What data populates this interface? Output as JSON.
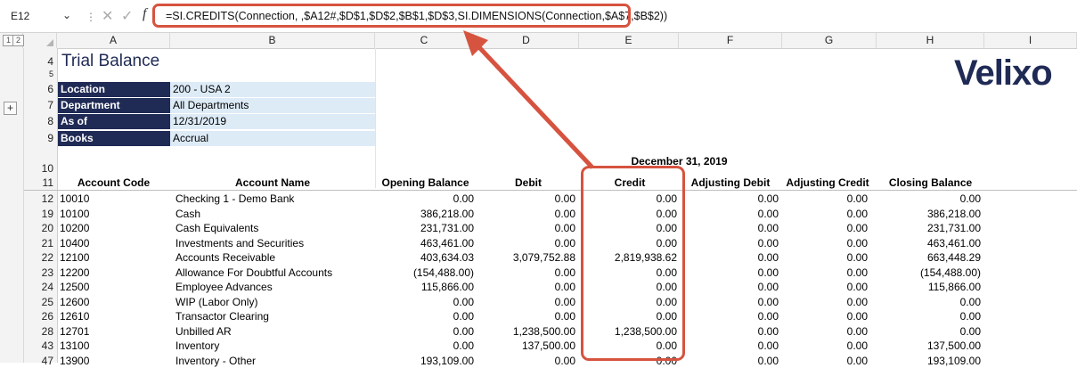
{
  "name_box": "E12",
  "formula": "=SI.CREDITS(Connection, ,$A12#,$D$1,$D$2,$B$1,$D$3,SI.DIMENSIONS(Connection,$A$7,$B$2))",
  "outline_levels": [
    "1",
    "2"
  ],
  "outline_expand": "+",
  "columns": [
    "A",
    "B",
    "C",
    "D",
    "E",
    "F",
    "G",
    "H",
    "I"
  ],
  "title": "Trial Balance",
  "logo_text": "Velixo",
  "params": [
    {
      "label": "Location",
      "value": "200 - USA 2"
    },
    {
      "label": "Department",
      "value": "All Departments"
    },
    {
      "label": "As of",
      "value": "12/31/2019"
    },
    {
      "label": "Books",
      "value": "Accrual"
    }
  ],
  "period_heading": "December 31, 2019",
  "table_headers": [
    "Account Code",
    "Account Name",
    "Opening Balance",
    "Debit",
    "Credit",
    "Adjusting Debit",
    "Adjusting Credit",
    "Closing Balance"
  ],
  "rows": [
    {
      "row": "12",
      "code": "10010",
      "name": "Checking 1 - Demo Bank",
      "opening": "0.00",
      "debit": "0.00",
      "credit": "0.00",
      "adj_debit": "0.00",
      "adj_credit": "0.00",
      "closing": "0.00"
    },
    {
      "row": "19",
      "code": "10100",
      "name": "Cash",
      "opening": "386,218.00",
      "debit": "0.00",
      "credit": "0.00",
      "adj_debit": "0.00",
      "adj_credit": "0.00",
      "closing": "386,218.00"
    },
    {
      "row": "20",
      "code": "10200",
      "name": "Cash Equivalents",
      "opening": "231,731.00",
      "debit": "0.00",
      "credit": "0.00",
      "adj_debit": "0.00",
      "adj_credit": "0.00",
      "closing": "231,731.00"
    },
    {
      "row": "21",
      "code": "10400",
      "name": "Investments and Securities",
      "opening": "463,461.00",
      "debit": "0.00",
      "credit": "0.00",
      "adj_debit": "0.00",
      "adj_credit": "0.00",
      "closing": "463,461.00"
    },
    {
      "row": "22",
      "code": "12100",
      "name": "Accounts Receivable",
      "opening": "403,634.03",
      "debit": "3,079,752.88",
      "credit": "2,819,938.62",
      "adj_debit": "0.00",
      "adj_credit": "0.00",
      "closing": "663,448.29"
    },
    {
      "row": "23",
      "code": "12200",
      "name": "Allowance For Doubtful Accounts",
      "opening": "(154,488.00)",
      "debit": "0.00",
      "credit": "0.00",
      "adj_debit": "0.00",
      "adj_credit": "0.00",
      "closing": "(154,488.00)"
    },
    {
      "row": "24",
      "code": "12500",
      "name": "Employee Advances",
      "opening": "115,866.00",
      "debit": "0.00",
      "credit": "0.00",
      "adj_debit": "0.00",
      "adj_credit": "0.00",
      "closing": "115,866.00"
    },
    {
      "row": "25",
      "code": "12600",
      "name": "WIP (Labor Only)",
      "opening": "0.00",
      "debit": "0.00",
      "credit": "0.00",
      "adj_debit": "0.00",
      "adj_credit": "0.00",
      "closing": "0.00"
    },
    {
      "row": "26",
      "code": "12610",
      "name": "Transactor Clearing",
      "opening": "0.00",
      "debit": "0.00",
      "credit": "0.00",
      "adj_debit": "0.00",
      "adj_credit": "0.00",
      "closing": "0.00"
    },
    {
      "row": "28",
      "code": "12701",
      "name": "Unbilled AR",
      "opening": "0.00",
      "debit": "1,238,500.00",
      "credit": "1,238,500.00",
      "adj_debit": "0.00",
      "adj_credit": "0.00",
      "closing": "0.00"
    },
    {
      "row": "43",
      "code": "13100",
      "name": "Inventory",
      "opening": "0.00",
      "debit": "137,500.00",
      "credit": "0.00",
      "adj_debit": "0.00",
      "adj_credit": "0.00",
      "closing": "137,500.00"
    },
    {
      "row": "47",
      "code": "13900",
      "name": "Inventory - Other",
      "opening": "193,109.00",
      "debit": "0.00",
      "credit": "0.00",
      "adj_debit": "0.00",
      "adj_credit": "0.00",
      "closing": "193,109.00"
    }
  ],
  "header_row_numbers": [
    "4",
    "5",
    "6",
    "7",
    "8",
    "9",
    "10",
    "11"
  ],
  "colors": {
    "highlight": "#d6533f",
    "param_label_bg": "#1f2a55",
    "param_value_bg": "#ddebf7",
    "logo": "#1f2a55"
  }
}
